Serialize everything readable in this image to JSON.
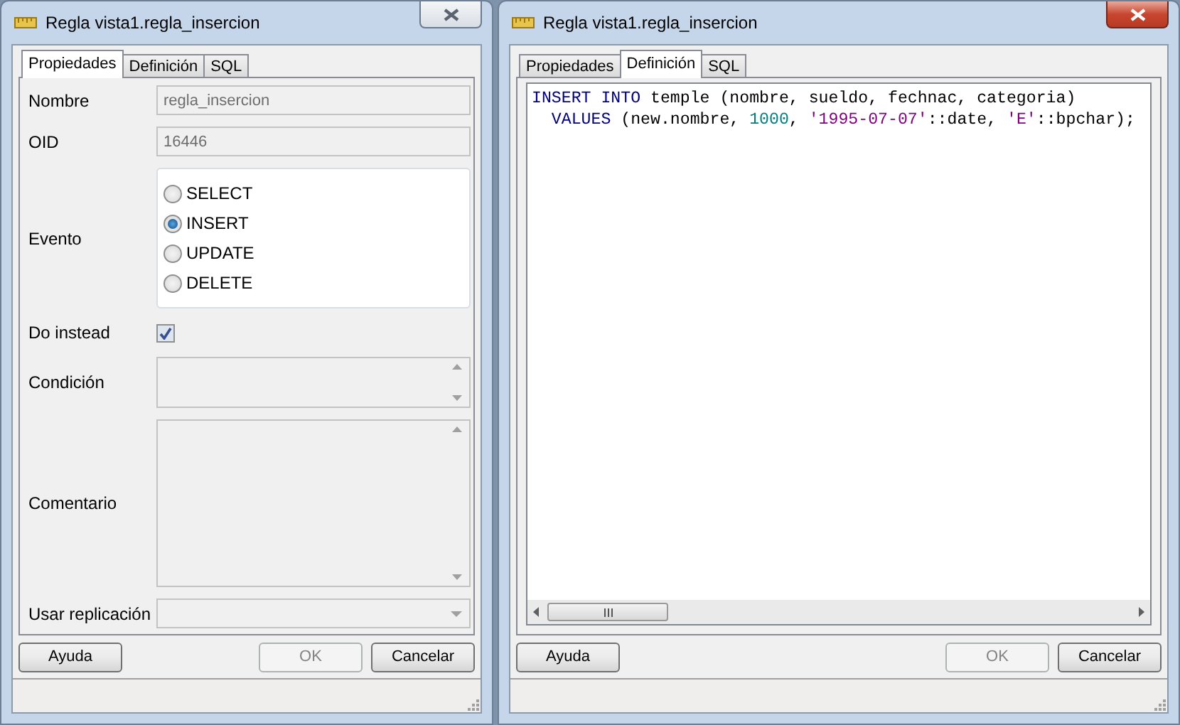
{
  "windows": [
    {
      "title": "Regla vista1.regla_insercion",
      "active": false,
      "tabs": [
        {
          "label": "Propiedades",
          "selected": true
        },
        {
          "label": "Definición",
          "selected": false
        },
        {
          "label": "SQL",
          "selected": false
        }
      ],
      "form": {
        "fields": [
          {
            "kind": "text",
            "label": "Nombre",
            "value": "regla_insercion",
            "disabled": true
          },
          {
            "kind": "text",
            "label": "OID",
            "value": "16446",
            "disabled": true
          },
          {
            "kind": "radio",
            "label": "Evento",
            "options": [
              {
                "label": "SELECT",
                "selected": false
              },
              {
                "label": "INSERT",
                "selected": true
              },
              {
                "label": "UPDATE",
                "selected": false
              },
              {
                "label": "DELETE",
                "selected": false
              }
            ]
          },
          {
            "kind": "checkbox",
            "label": "Do instead",
            "checked": true
          },
          {
            "kind": "textarea",
            "label": "Condición"
          },
          {
            "kind": "memo",
            "label": "Comentario"
          },
          {
            "kind": "select",
            "label": "Usar replicación",
            "disabled": true
          }
        ]
      },
      "buttons": [
        {
          "label": "Ayuda",
          "disabled": false,
          "kind": "left"
        },
        {
          "label": "OK",
          "disabled": true,
          "kind": "right"
        },
        {
          "label": "Cancelar",
          "disabled": false,
          "kind": "right"
        }
      ]
    },
    {
      "title": "Regla vista1.regla_insercion",
      "active": true,
      "tabs": [
        {
          "label": "Propiedades",
          "selected": false
        },
        {
          "label": "Definición",
          "selected": true
        },
        {
          "label": "SQL",
          "selected": false
        }
      ],
      "editor": {
        "lines": [
          [
            {
              "kind": "keyword",
              "text": "INSERT"
            },
            {
              "kind": "keyword",
              "text": " INTO"
            },
            {
              "kind": "plain",
              "text": " temple (nombre, sueldo, fechnac, categoria)"
            }
          ],
          [
            {
              "kind": "keyword",
              "text": "  VALUES"
            },
            {
              "kind": "plain",
              "text": " (new.nombre, "
            },
            {
              "kind": "number",
              "text": "1000"
            },
            {
              "kind": "plain",
              "text": ", "
            },
            {
              "kind": "string",
              "text": "'1995-07-07'"
            },
            {
              "kind": "plain",
              "text": "::date, "
            },
            {
              "kind": "string",
              "text": "'E'"
            },
            {
              "kind": "plain",
              "text": "::bpchar);"
            }
          ]
        ]
      },
      "buttons": [
        {
          "label": "Ayuda",
          "disabled": false,
          "kind": "left"
        },
        {
          "label": "OK",
          "disabled": true,
          "kind": "right"
        },
        {
          "label": "Cancelar",
          "disabled": false,
          "kind": "right"
        }
      ]
    }
  ]
}
